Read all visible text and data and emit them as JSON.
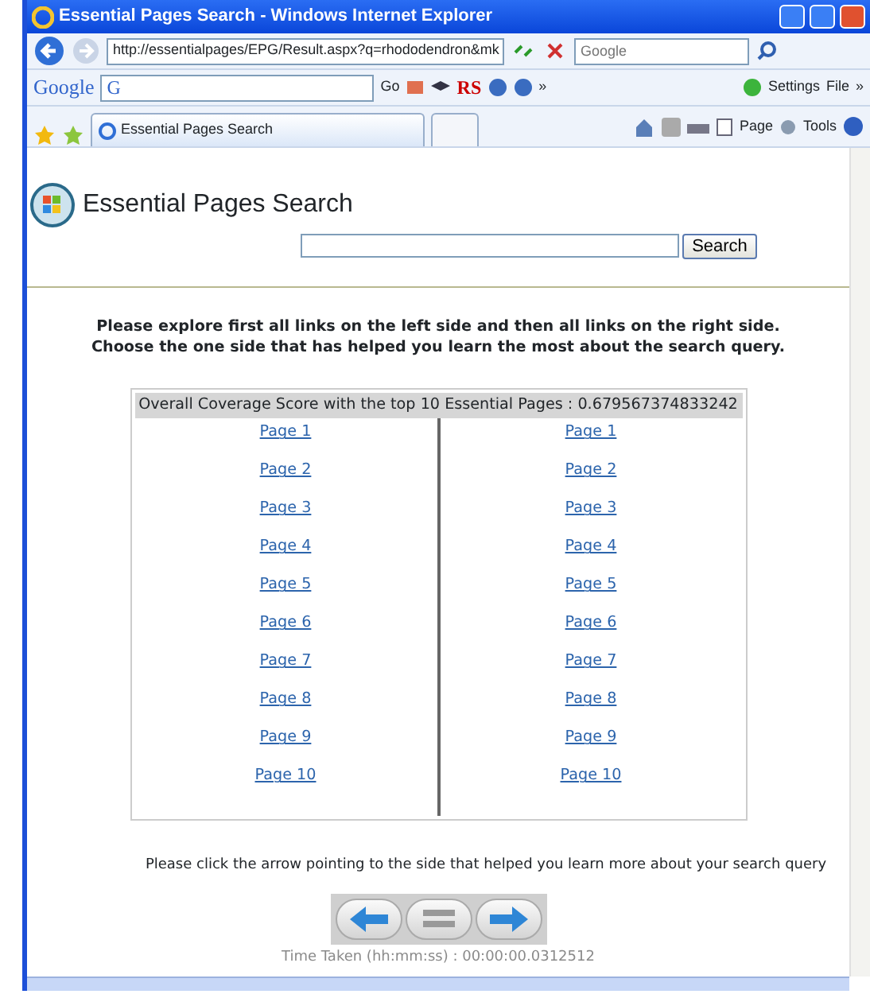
{
  "window": {
    "title": "Essential Pages Search - Windows Internet Explorer"
  },
  "address_bar": {
    "url": "http://essentialpages/EPG/Result.aspx?q=rhododendron&mk"
  },
  "search_box": {
    "placeholder": "Google"
  },
  "google_toolbar": {
    "logo": "Google",
    "letter": "G",
    "go": "Go",
    "rs": "RS",
    "more": "»",
    "settings": "Settings",
    "file": "File",
    "overflow": "»"
  },
  "tabs": [
    {
      "title": "Essential Pages Search",
      "selected": true
    }
  ],
  "command_bar": [
    "Page",
    "Tools"
  ],
  "page": {
    "heading": "Essential Pages Search",
    "search_button": "Search",
    "instructions": [
      "Please explore first all links on the left side and then all links on the right side.",
      "Choose the one side that has helped you learn the most about the search query."
    ],
    "score_header": "Overall Coverage Score with the top 10 Essential Pages : 0.679567374833242",
    "left_links": [
      "Page 1",
      "Page 2",
      "Page 3",
      "Page 4",
      "Page 5",
      "Page 6",
      "Page 7",
      "Page 8",
      "Page 9",
      "Page 10"
    ],
    "right_links": [
      "Page 1",
      "Page 2",
      "Page 3",
      "Page 4",
      "Page 5",
      "Page 6",
      "Page 7",
      "Page 8",
      "Page 9",
      "Page 10"
    ],
    "prompt": "Please click the arrow pointing to the side that helped you learn more about your search query",
    "time_taken": "Time Taken (hh:mm:ss) : 00:00:00.0312512"
  }
}
